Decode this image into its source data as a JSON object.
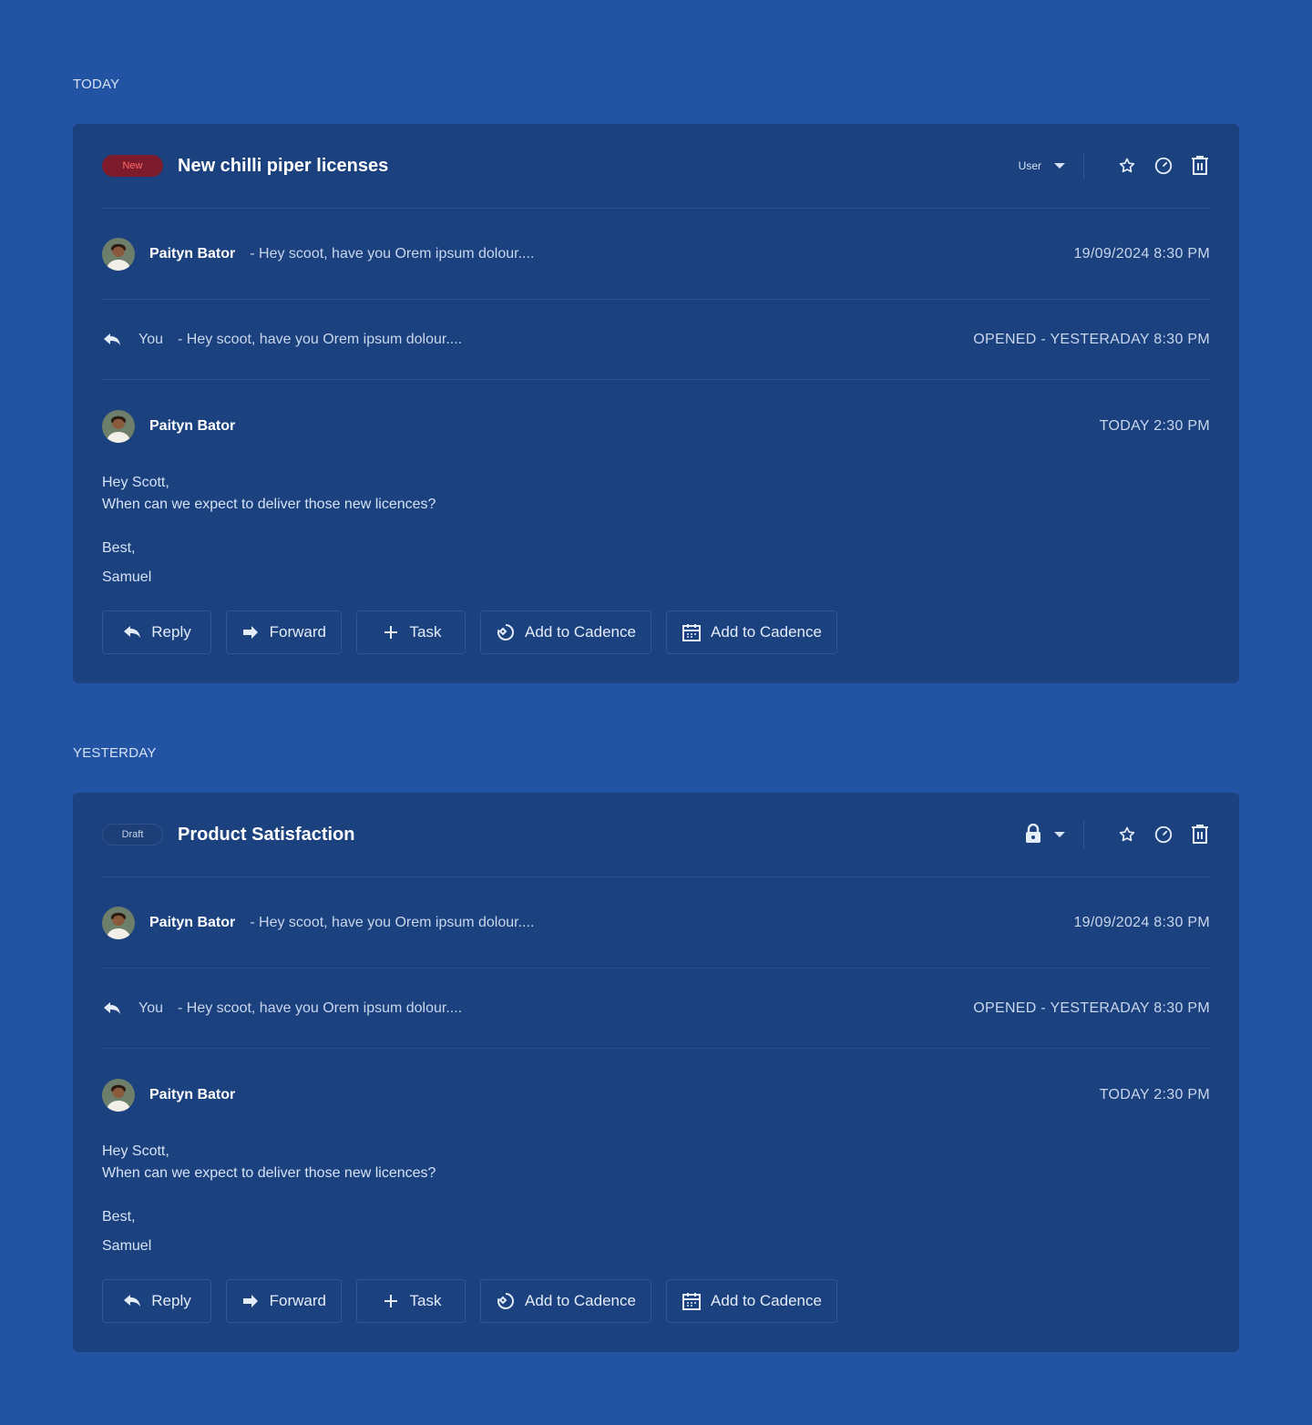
{
  "colors": {
    "background": "#2354a3",
    "card": "#1b417f",
    "new_badge_bg": "#7b1b2b",
    "new_badge_text": "#ff6a6a",
    "text_muted": "#c9d6ec"
  },
  "groups": [
    {
      "label": "TODAY",
      "badge": "New",
      "subject": "New chilli piper licenses",
      "owner_label": "User",
      "owner_icon": "none",
      "messages": {
        "incoming": {
          "sender": "Paityn Bator",
          "snippet": "- Hey scoot, have you Orem ipsum dolour....",
          "time": "19/09/2024 8:30 PM"
        },
        "reply": {
          "sender": "You",
          "snippet": "- Hey scoot, have you Orem ipsum dolour....",
          "time": "OPENED - YESTERADAY 8:30 PM"
        },
        "expanded": {
          "sender": "Paityn Bator",
          "time": "TODAY 2:30 PM"
        }
      },
      "body": {
        "greeting": "Hey Scott,",
        "line": "When can we expect to deliver those new licences?",
        "signoff": "Best,",
        "signature": "Samuel"
      },
      "actions": [
        "Reply",
        "Forward",
        "Task",
        "Add to Cadence",
        "Add to Cadence"
      ]
    },
    {
      "label": "YESTERDAY",
      "badge": "Draft",
      "subject": "Product Satisfaction",
      "owner_label": "",
      "owner_icon": "lock-icon",
      "messages": {
        "incoming": {
          "sender": "Paityn Bator",
          "snippet": "- Hey scoot, have you Orem ipsum dolour....",
          "time": "19/09/2024 8:30 PM"
        },
        "reply": {
          "sender": "You",
          "snippet": "- Hey scoot, have you Orem ipsum dolour....",
          "time": "OPENED - YESTERADAY 8:30 PM"
        },
        "expanded": {
          "sender": "Paityn Bator",
          "time": "TODAY 2:30 PM"
        }
      },
      "body": {
        "greeting": "Hey Scott,",
        "line": "When can we expect to deliver those new licences?",
        "signoff": "Best,",
        "signature": "Samuel"
      },
      "actions": [
        "Reply",
        "Forward",
        "Task",
        "Add to Cadence",
        "Add to Cadence"
      ]
    }
  ]
}
